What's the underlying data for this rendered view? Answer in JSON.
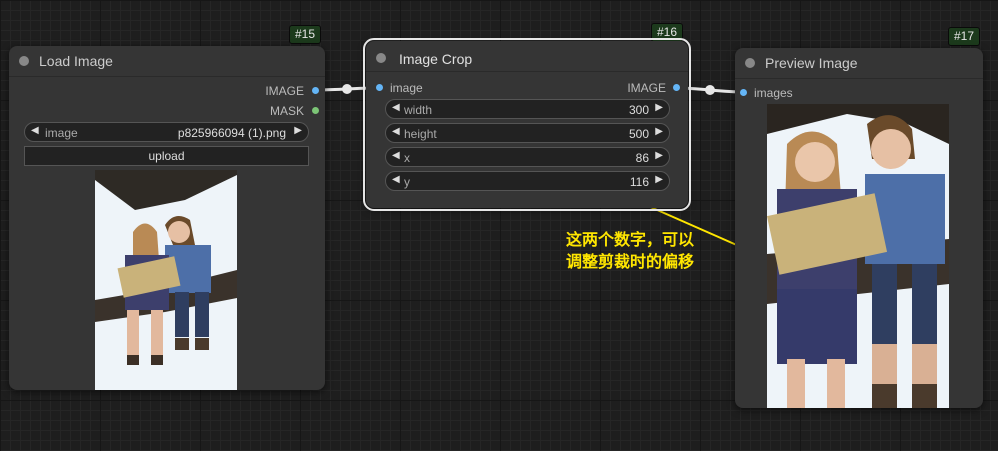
{
  "nodes": {
    "load_image": {
      "badge": "#15",
      "title": "Load Image",
      "outputs": [
        "IMAGE",
        "MASK"
      ],
      "image_label": "image",
      "image_value": "p825966094 (1).png",
      "upload_label": "upload"
    },
    "image_crop": {
      "badge": "#16",
      "title": "Image Crop",
      "input": "image",
      "output": "IMAGE",
      "widgets": [
        {
          "label": "width",
          "value": "300"
        },
        {
          "label": "height",
          "value": "500"
        },
        {
          "label": "x",
          "value": "86"
        },
        {
          "label": "y",
          "value": "116"
        }
      ]
    },
    "preview_image": {
      "badge": "#17",
      "title": "Preview Image",
      "input": "images"
    }
  },
  "annotation": {
    "line1": "这两个数字，可以",
    "line2": "调整剪裁时的偏移",
    "color": "#ffe600"
  },
  "icons": {
    "arrow_left": "◀",
    "arrow_right": "▶"
  },
  "colors": {
    "image_slot": "#64b5f6",
    "mask_slot": "#7cc576",
    "badge_bg": "#1c3a1c"
  }
}
